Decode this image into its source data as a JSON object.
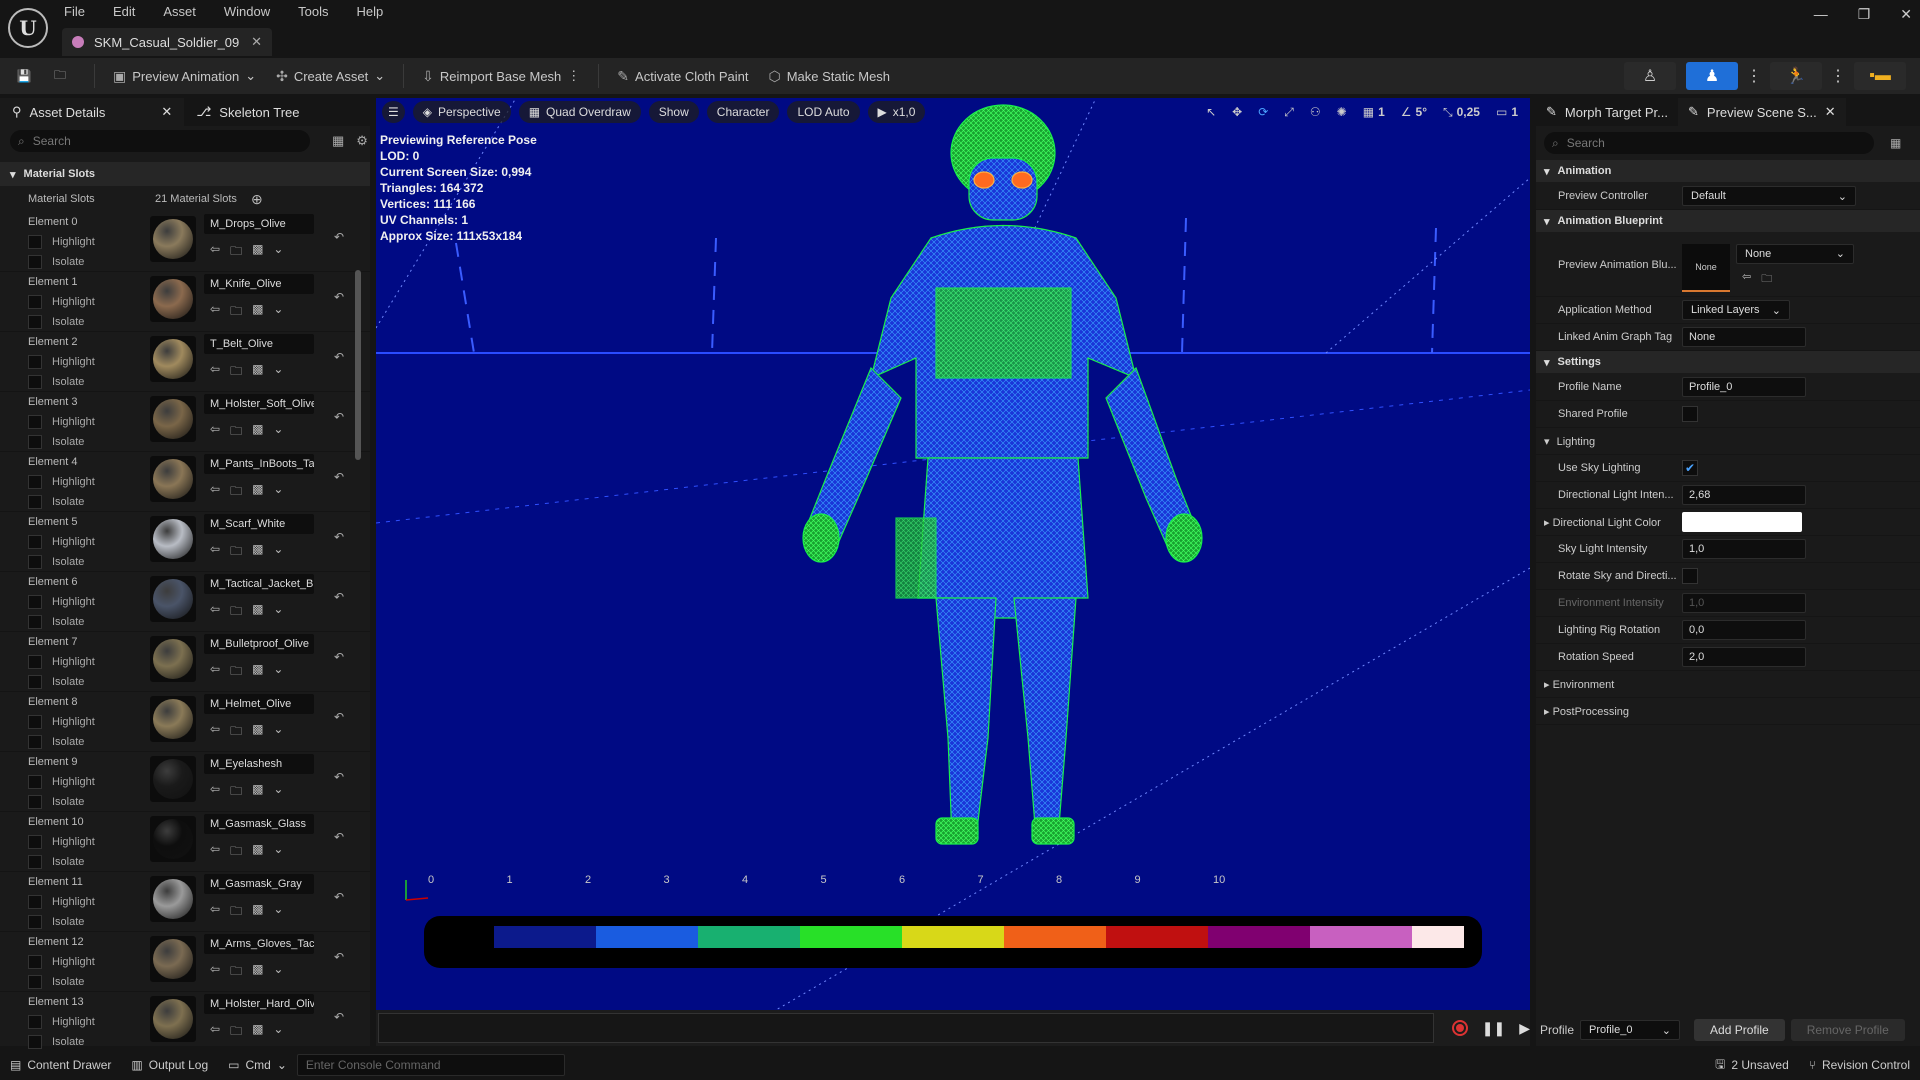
{
  "menu": [
    "File",
    "Edit",
    "Asset",
    "Window",
    "Tools",
    "Help"
  ],
  "doc_tab": "SKM_Casual_Soldier_09",
  "toolbar": {
    "preview_animation": "Preview Animation",
    "create_asset": "Create Asset",
    "reimport": "Reimport Base Mesh",
    "cloth_paint": "Activate Cloth Paint",
    "static_mesh": "Make Static Mesh"
  },
  "left_panel": {
    "tabs": [
      "Asset Details",
      "Skeleton Tree"
    ],
    "search_placeholder": "Search",
    "section": "Material Slots",
    "slots_label": "Material Slots",
    "slots_count": "21 Material Slots",
    "highlight": "Highlight",
    "isolate": "Isolate",
    "elements": [
      {
        "name": "Element 0",
        "material": "M_Drops_Olive",
        "color": "#8a7a5c"
      },
      {
        "name": "Element 1",
        "material": "M_Knife_Olive",
        "color": "#8b6a4e"
      },
      {
        "name": "Element 2",
        "material": "T_Belt_Olive",
        "color": "#a08a5e"
      },
      {
        "name": "Element 3",
        "material": "M_Holster_Soft_Olive",
        "color": "#7a6648"
      },
      {
        "name": "Element 4",
        "material": "M_Pants_InBoots_Tan",
        "color": "#8a7656"
      },
      {
        "name": "Element 5",
        "material": "M_Scarf_White",
        "color": "#b8bcc4"
      },
      {
        "name": "Element 6",
        "material": "M_Tactical_Jacket_Blue",
        "color": "#4a5468"
      },
      {
        "name": "Element 7",
        "material": "M_Bulletproof_Olive",
        "color": "#7c7050"
      },
      {
        "name": "Element 8",
        "material": "M_Helmet_Olive",
        "color": "#8a7a58"
      },
      {
        "name": "Element 9",
        "material": "M_Eyelashesh",
        "color": "#1a1a1a"
      },
      {
        "name": "Element 10",
        "material": "M_Gasmask_Glass",
        "color": "#0e0e0e"
      },
      {
        "name": "Element 11",
        "material": "M_Gasmask_Gray",
        "color": "#9a9a9a"
      },
      {
        "name": "Element 12",
        "material": "M_Arms_Gloves_Tac",
        "color": "#7a6a52"
      },
      {
        "name": "Element 13",
        "material": "M_Holster_Hard_Olive",
        "color": "#7e7050"
      }
    ]
  },
  "viewport": {
    "view": "Perspective",
    "mode": "Quad Overdraw",
    "show": "Show",
    "character": "Character",
    "lod": "LOD Auto",
    "speed": "x1,0",
    "grid_count": "1",
    "angle": "5°",
    "scale": "0,25",
    "cam": "1",
    "info": [
      "Previewing Reference Pose",
      "LOD: 0",
      "Current Screen Size: 0,994",
      "Triangles: 164 372",
      "Vertices: 111 166",
      "UV Channels: 1",
      "Approx Size: 111x53x184"
    ],
    "axis": [
      "0",
      "1",
      "2",
      "3",
      "4",
      "5",
      "6",
      "7",
      "8",
      "9",
      "10"
    ],
    "legend_colors": [
      "#000000",
      "#0c1a8c",
      "#1a5ce0",
      "#18b070",
      "#28e028",
      "#d8d818",
      "#f06018",
      "#c01010",
      "#800070",
      "#c860c0",
      "#fce8e8"
    ]
  },
  "right_panel": {
    "tabs": [
      "Morph Target Pr...",
      "Preview Scene S..."
    ],
    "search_placeholder": "Search",
    "animation": {
      "title": "Animation",
      "controller_label": "Preview Controller",
      "controller": "Default"
    },
    "blueprint": {
      "title": "Animation Blueprint",
      "preview_label": "Preview Animation Blu...",
      "thumb": "None",
      "preview_value": "None",
      "method_label": "Application Method",
      "method": "Linked Layers",
      "tag_label": "Linked Anim Graph Tag",
      "tag": "None"
    },
    "settings": {
      "title": "Settings",
      "profile_label": "Profile Name",
      "profile": "Profile_0",
      "shared_label": "Shared Profile"
    },
    "lighting": {
      "title": "Lighting",
      "sky_label": "Use Sky Lighting",
      "dir_int_label": "Directional Light Inten...",
      "dir_int": "2,68",
      "dir_color_label": "Directional Light Color",
      "sky_int_label": "Sky Light Intensity",
      "sky_int": "1,0",
      "rotate_label": "Rotate Sky and Directi...",
      "env_int_label": "Environment Intensity",
      "env_int": "1,0",
      "rig_rot_label": "Lighting Rig Rotation",
      "rig_rot": "0,0",
      "rot_speed_label": "Rotation Speed",
      "rot_speed": "2,0"
    },
    "env": "Environment",
    "post": "PostProcessing",
    "profile_label": "Profile",
    "profile_value": "Profile_0",
    "add_profile": "Add Profile",
    "remove_profile": "Remove Profile"
  },
  "status": {
    "content_drawer": "Content Drawer",
    "output_log": "Output Log",
    "cmd": "Cmd",
    "console_placeholder": "Enter Console Command",
    "unsaved": "2 Unsaved",
    "revision": "Revision Control"
  }
}
